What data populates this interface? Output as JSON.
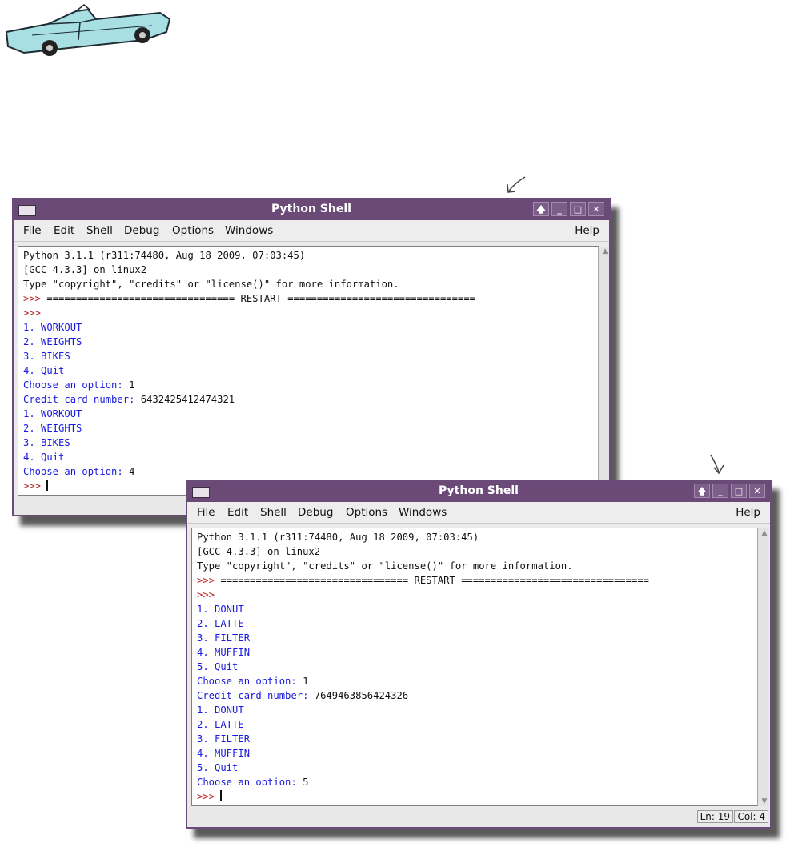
{
  "window1": {
    "title": "Python Shell",
    "menus": [
      "File",
      "Edit",
      "Shell",
      "Debug",
      "Options",
      "Windows"
    ],
    "help": "Help",
    "controls": [
      "up-arrow",
      "minimize",
      "maximize",
      "close"
    ],
    "lines": [
      {
        "text": "Python 3.1.1 (r311:74480, Aug 18 2009, 07:03:45)",
        "color": "black"
      },
      {
        "text": "[GCC 4.3.3] on linux2",
        "color": "black"
      },
      {
        "text": "Type \"copyright\", \"credits\" or \"license()\" for more information.",
        "color": "black"
      },
      {
        "prompt": ">>> ",
        "text": "================================ RESTART ================================",
        "color": "black"
      },
      {
        "prompt": ">>>",
        "text": "",
        "color": "black"
      },
      {
        "text": "1. WORKOUT",
        "color": "blue"
      },
      {
        "text": "2. WEIGHTS",
        "color": "blue"
      },
      {
        "text": "3. BIKES",
        "color": "blue"
      },
      {
        "text": "4. Quit",
        "color": "blue"
      },
      {
        "text": "Choose an option: ",
        "value": "1",
        "color": "blue"
      },
      {
        "text": "Credit card number: ",
        "value": "6432425412474321",
        "color": "blue"
      },
      {
        "text": "1. WORKOUT",
        "color": "blue"
      },
      {
        "text": "2. WEIGHTS",
        "color": "blue"
      },
      {
        "text": "3. BIKES",
        "color": "blue"
      },
      {
        "text": "4. Quit",
        "color": "blue"
      },
      {
        "text": "Choose an option: ",
        "value": "4",
        "color": "blue"
      },
      {
        "prompt": ">>> ",
        "text": "",
        "color": "black",
        "cursor": true
      }
    ]
  },
  "window2": {
    "title": "Python Shell",
    "menus": [
      "File",
      "Edit",
      "Shell",
      "Debug",
      "Options",
      "Windows"
    ],
    "help": "Help",
    "controls": [
      "up-arrow",
      "minimize",
      "maximize",
      "close"
    ],
    "lines": [
      {
        "text": "Python 3.1.1 (r311:74480, Aug 18 2009, 07:03:45)",
        "color": "black"
      },
      {
        "text": "[GCC 4.3.3] on linux2",
        "color": "black"
      },
      {
        "text": "Type \"copyright\", \"credits\" or \"license()\" for more information.",
        "color": "black"
      },
      {
        "prompt": ">>> ",
        "text": "================================ RESTART ================================",
        "color": "black"
      },
      {
        "prompt": ">>>",
        "text": "",
        "color": "black"
      },
      {
        "text": "1. DONUT",
        "color": "blue"
      },
      {
        "text": "2. LATTE",
        "color": "blue"
      },
      {
        "text": "3. FILTER",
        "color": "blue"
      },
      {
        "text": "4. MUFFIN",
        "color": "blue"
      },
      {
        "text": "5. Quit",
        "color": "blue"
      },
      {
        "text": "Choose an option: ",
        "value": "1",
        "color": "blue"
      },
      {
        "text": "Credit card number: ",
        "value": "7649463856424326",
        "color": "blue"
      },
      {
        "text": "1. DONUT",
        "color": "blue"
      },
      {
        "text": "2. LATTE",
        "color": "blue"
      },
      {
        "text": "3. FILTER",
        "color": "blue"
      },
      {
        "text": "4. MUFFIN",
        "color": "blue"
      },
      {
        "text": "5. Quit",
        "color": "blue"
      },
      {
        "text": "Choose an option: ",
        "value": "5",
        "color": "blue"
      },
      {
        "prompt": ">>> ",
        "text": "",
        "color": "black",
        "cursor": true
      }
    ],
    "status": {
      "line": "Ln: 19",
      "col": "Col: 4"
    }
  },
  "colors": {
    "titlebar": "#6b4a78",
    "prompt": "#b81d1d",
    "output": "#1a1ae0",
    "text": "#111111"
  }
}
